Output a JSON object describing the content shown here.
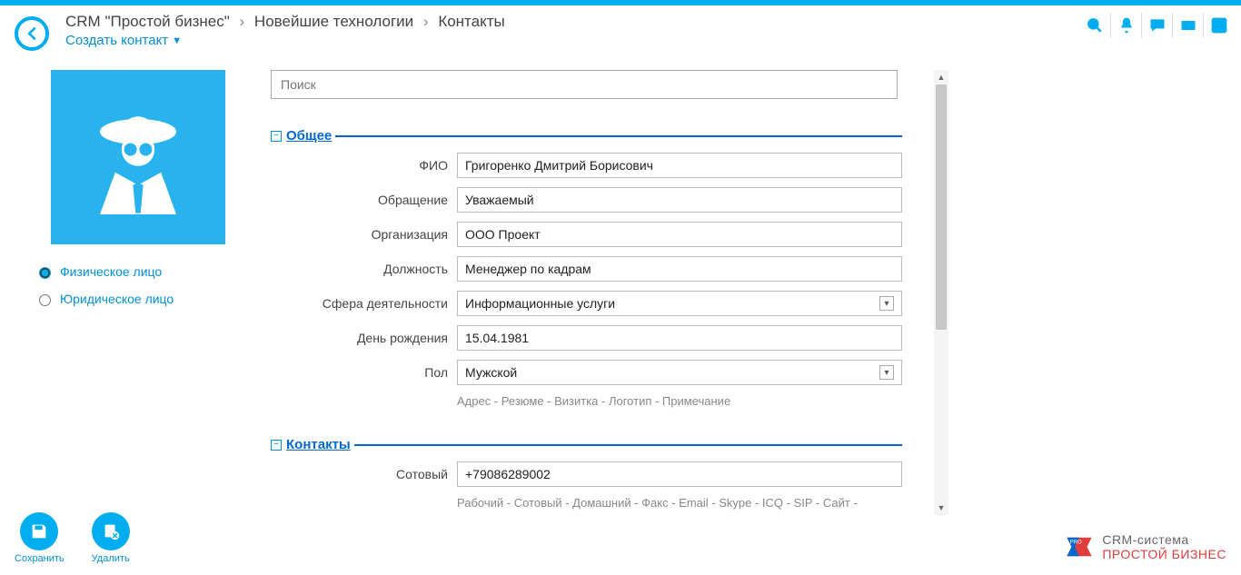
{
  "breadcrumbs": {
    "a": "CRM \"Простой бизнес\"",
    "b": "Новейшие технологии",
    "c": "Контакты"
  },
  "header": {
    "create": "Создать контакт"
  },
  "radios": {
    "person": "Физическое лицо",
    "legal": "Юридическое лицо"
  },
  "search": {
    "placeholder": "Поиск"
  },
  "sections": {
    "general": "Общее",
    "contacts": "Контакты"
  },
  "fields": {
    "fio": {
      "label": "ФИО",
      "value": "Григоренко Дмитрий Борисович"
    },
    "salutation": {
      "label": "Обращение",
      "value": "Уважаемый"
    },
    "org": {
      "label": "Организация",
      "value": "ООО Проект"
    },
    "position": {
      "label": "Должность",
      "value": "Менеджер по кадрам"
    },
    "sphere": {
      "label": "Сфера деятельности",
      "value": "Информационные услуги"
    },
    "birthday": {
      "label": "День рождения",
      "value": "15.04.1981"
    },
    "gender": {
      "label": "Пол",
      "value": "Мужской"
    },
    "mobile": {
      "label": "Сотовый",
      "value": "+79086289002"
    }
  },
  "extras_general": "Адрес -  Резюме -  Визитка -  Логотип -  Примечание",
  "extras_contacts": "Рабочий -  Сотовый -  Домашний -  Факс -  Email -  Skype -  ICQ -  SIP -  Сайт -",
  "actions": {
    "save": "Сохранить",
    "delete": "Удалить"
  },
  "brand": {
    "l1": "CRM-система",
    "l2": "ПРОСТОЙ БИЗНЕС"
  }
}
